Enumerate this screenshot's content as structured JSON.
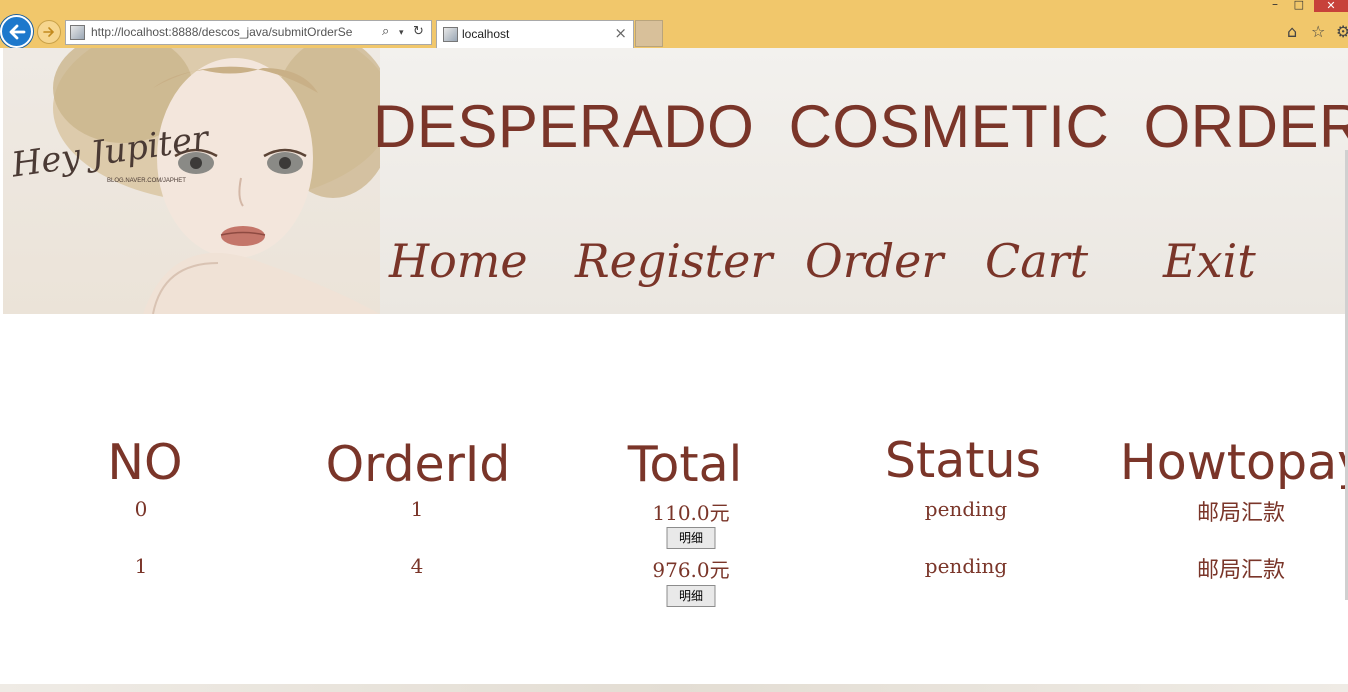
{
  "browser": {
    "url": "http://localhost:8888/descos_java/submitOrderSe",
    "tab_title": "localhost",
    "close_glyph": "×"
  },
  "header": {
    "title": "DESPERADO  COSMETIC  ORDER",
    "logo_text": "Hey Jupiter",
    "logo_subtext": "BLOG.NAVER.COM/JAPHET",
    "nav": [
      {
        "label": "Home"
      },
      {
        "label": "Register"
      },
      {
        "label": "Order"
      },
      {
        "label": "Cart"
      },
      {
        "label": "Exit"
      }
    ]
  },
  "orders": {
    "columns": [
      "NO",
      "OrderId",
      "Total",
      "Status",
      "Howtopay"
    ],
    "rows": [
      {
        "no": "0",
        "order_id": "1",
        "total": "110.0元",
        "status": "pending",
        "howtopay": "邮局汇款",
        "detail_label": "明细"
      },
      {
        "no": "1",
        "order_id": "4",
        "total": "976.0元",
        "status": "pending",
        "howtopay": "邮局汇款",
        "detail_label": "明细"
      }
    ]
  },
  "colors": {
    "accent": "#7a3529",
    "chrome": "#f1c76b",
    "back_button": "#1d78cc"
  }
}
